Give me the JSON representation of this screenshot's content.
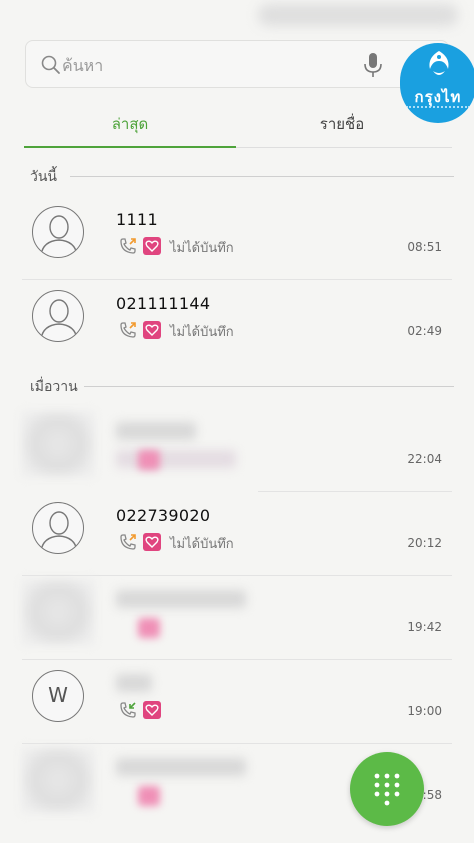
{
  "search": {
    "placeholder": "ค้นหา"
  },
  "bank_logo": {
    "text": "กรุงไท"
  },
  "tabs": [
    {
      "label": "ล่าสุด",
      "active": true
    },
    {
      "label": "รายชื่อ",
      "active": false
    }
  ],
  "sections": {
    "today": "วันนี้",
    "yesterday": "เมื่อวาน"
  },
  "calls": [
    {
      "name": "1111",
      "status": "ไม่ได้บันทึก",
      "time": "08:51"
    },
    {
      "name": "021111144",
      "status": "ไม่ได้บันทึก",
      "time": "02:49"
    },
    {
      "name": "",
      "status": "",
      "time": "22:04",
      "blurred": true
    },
    {
      "name": "022739020",
      "status": "ไม่ได้บันทึก",
      "time": "20:12"
    },
    {
      "name": "",
      "status": "",
      "time": "19:42",
      "blurred": true
    },
    {
      "name": "",
      "status": "",
      "time": "19:00",
      "avatar_letter": "W",
      "blurred_name": true
    },
    {
      "name": "",
      "status": "",
      "time": "18:58",
      "blurred": true
    }
  ],
  "colors": {
    "accent": "#4ea33a",
    "fab": "#5cba47",
    "badge": "#e0457f",
    "bank": "#1aa0e0"
  },
  "icons": {
    "search": "search-icon",
    "mic": "mic-icon",
    "outgoing_call": "outgoing-call-icon",
    "incoming_call": "incoming-call-icon",
    "dialpad": "dialpad-icon"
  }
}
